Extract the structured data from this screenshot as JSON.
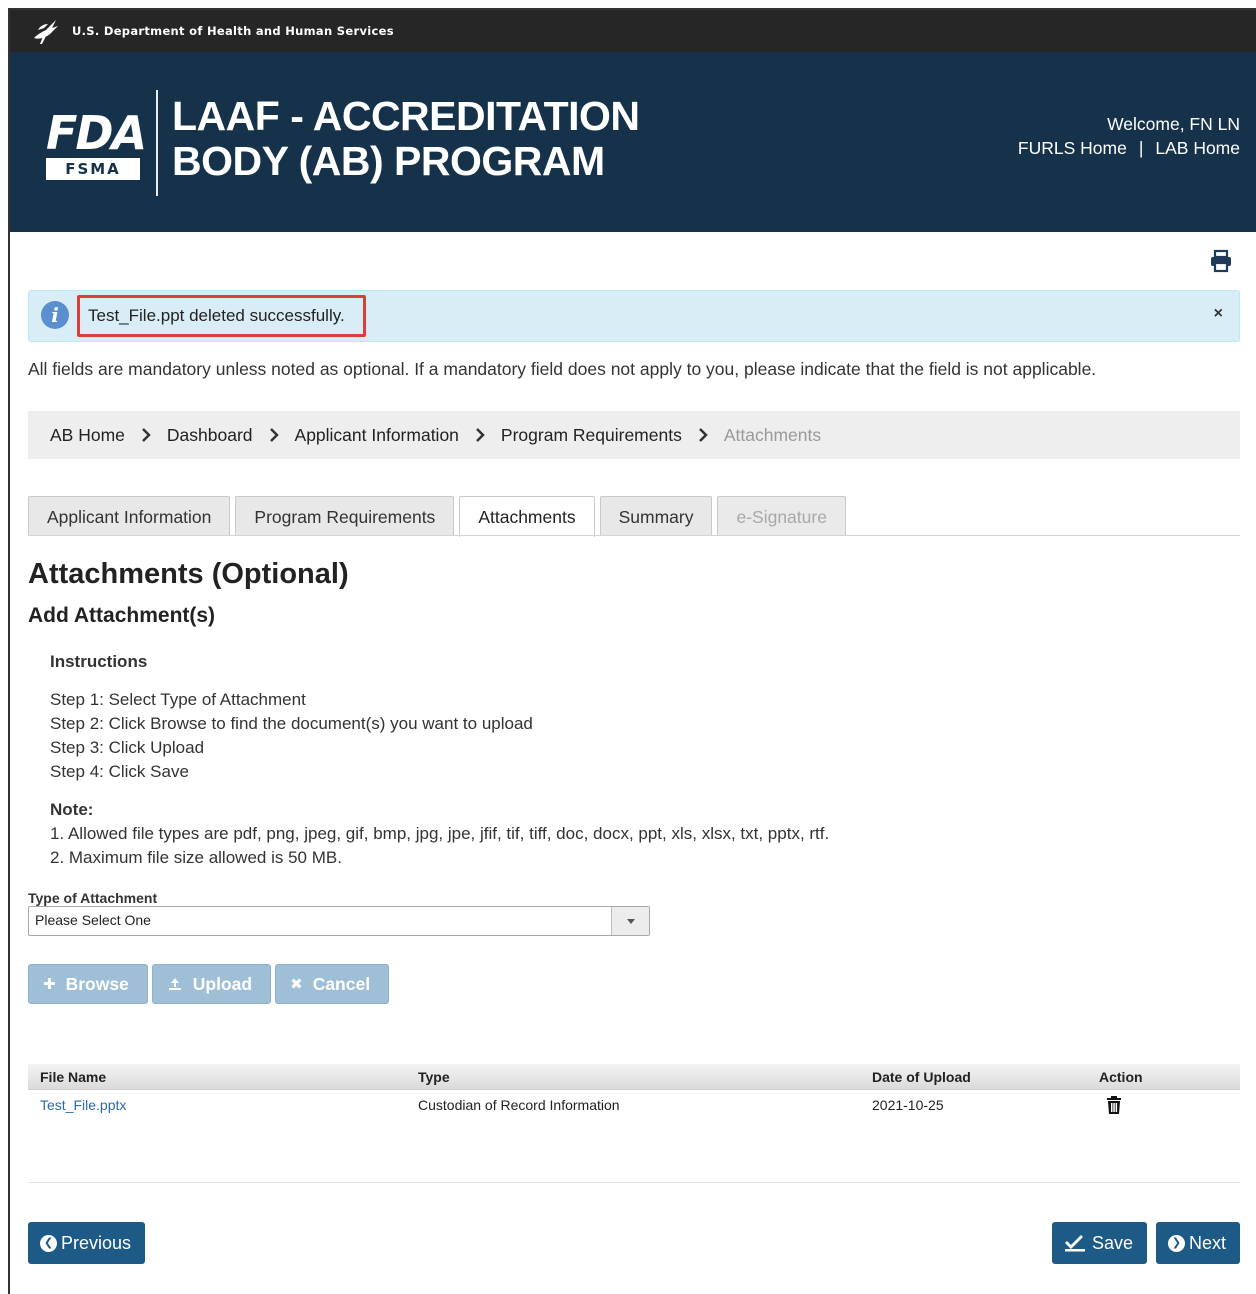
{
  "header": {
    "agency": "U.S. Department of Health and Human Services",
    "logo_fda": "FDA",
    "logo_fsma": "FSMA",
    "title_line1": "LAAF - ACCREDITATION",
    "title_line2": "BODY (AB) PROGRAM",
    "welcome": "Welcome, FN LN",
    "link_furls": "FURLS Home",
    "link_sep": "|",
    "link_lab": "LAB Home"
  },
  "alert": {
    "message": "Test_File.ppt deleted successfully.",
    "close": "×"
  },
  "mandatory_note": "All fields are mandatory unless noted as optional. If a mandatory field does not apply to you, please indicate that the field is not applicable.",
  "breadcrumb": [
    "AB Home",
    "Dashboard",
    "Applicant Information",
    "Program Requirements",
    "Attachments"
  ],
  "tabs": [
    {
      "label": "Applicant Information",
      "state": "normal"
    },
    {
      "label": "Program Requirements",
      "state": "normal"
    },
    {
      "label": "Attachments",
      "state": "active"
    },
    {
      "label": "Summary",
      "state": "normal"
    },
    {
      "label": "e-Signature",
      "state": "disabled"
    }
  ],
  "page": {
    "heading": "Attachments (Optional)",
    "subheading": "Add Attachment(s)"
  },
  "instructions": {
    "heading": "Instructions",
    "steps": [
      "Step 1: Select Type of Attachment",
      "Step 2: Click Browse to find the document(s) you want to upload",
      "Step 3: Click Upload",
      "Step 4: Click Save"
    ],
    "note_heading": "Note:",
    "notes": [
      "1. Allowed file types are pdf, png, jpeg, gif, bmp, jpg, jpe, jfif, tif, tiff, doc, docx, ppt, xls, xlsx, txt, pptx, rtf.",
      "2. Maximum file size allowed is 50 MB."
    ]
  },
  "attachment_type": {
    "label": "Type of Attachment",
    "selected": "Please Select One"
  },
  "upload_buttons": {
    "browse": "Browse",
    "upload": "Upload",
    "cancel": "Cancel"
  },
  "table": {
    "headers": [
      "File Name",
      "Type",
      "Date of Upload",
      "Action"
    ],
    "rows": [
      {
        "file_name": "Test_File.pptx",
        "type": "Custodian of Record Information",
        "date": "2021-10-25"
      }
    ]
  },
  "footer_buttons": {
    "previous": "Previous",
    "save": "Save",
    "next": "Next"
  },
  "colors": {
    "banner": "#15324a",
    "topbar": "#262626",
    "primary_button": "#1e5a86",
    "disabled_button": "#9ebfd6",
    "alert_bg": "#d9edf7",
    "highlight_border": "#d9403a",
    "link": "#2a6aab"
  }
}
